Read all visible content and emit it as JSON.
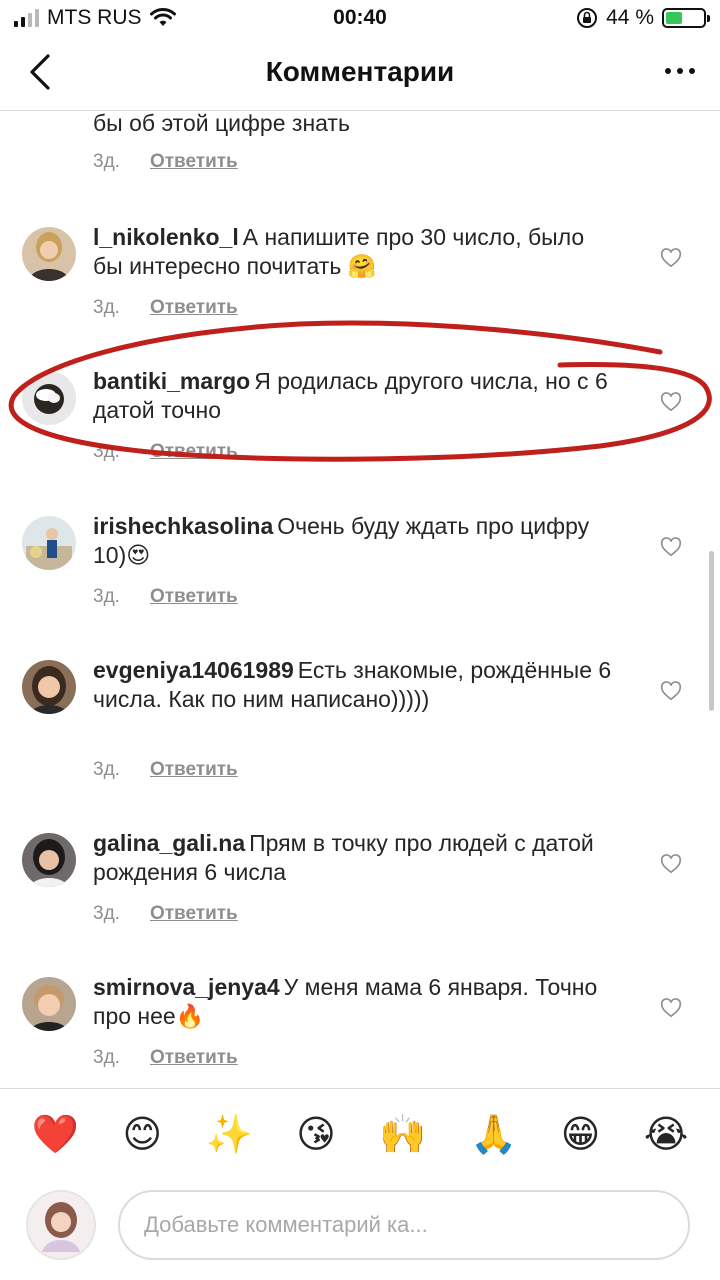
{
  "status": {
    "carrier": "MTS RUS",
    "time": "00:40",
    "battery": "44 %",
    "battery_level": 0.44
  },
  "nav": {
    "title": "Комментарии",
    "back_icon": "chevron-left-icon",
    "more_icon": "more-horizontal-icon"
  },
  "partial": {
    "text": "бы об этой цифре знать",
    "time": "3д.",
    "reply": "Ответить"
  },
  "comments": [
    {
      "user": "l_nikolenko_l",
      "text": "А напишите про 30 число, было бы интересно почитать 🤗",
      "time": "3д.",
      "reply": "Ответить"
    },
    {
      "user": "bantiki_margo",
      "text": "Я родилась другого числа, но с 6 датой точно",
      "time": "3д.",
      "reply": "Ответить"
    },
    {
      "user": "irishechkasolina",
      "text": "Очень буду ждать про цифру 10)😍",
      "time": "3д.",
      "reply": "Ответить"
    },
    {
      "user": "evgeniya14061989",
      "text": "Есть знакомые, рождённые 6 числа. Как по ним написано)))))",
      "time": "3д.",
      "reply": "Ответить"
    },
    {
      "user": "galina_gali.na",
      "text": "Прям в точку про людей с датой рождения 6 числа",
      "time": "3д.",
      "reply": "Ответить"
    },
    {
      "user": "smirnova_jenya4",
      "text": "У меня мама 6 января. Точно про нее🔥",
      "time": "3д.",
      "reply": "Ответить"
    }
  ],
  "emojis": [
    "❤️",
    "😊",
    "✨",
    "😘",
    "🙌",
    "🙏",
    "😁",
    "😭"
  ],
  "composer": {
    "placeholder": "Добавьте комментарий ка..."
  },
  "colors": {
    "annotation": "#c0201c",
    "text": "#262626",
    "secondary": "#8e8e8e",
    "divider": "#dbdbdb"
  }
}
